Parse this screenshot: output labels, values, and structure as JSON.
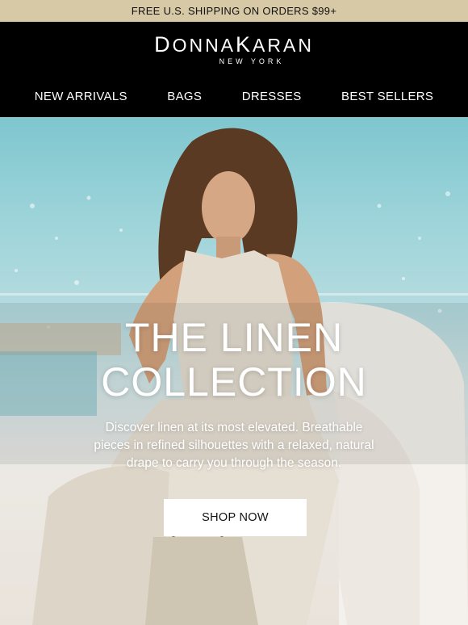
{
  "promo": {
    "text": "FREE U.S. SHIPPING ON ORDERS $99+"
  },
  "brand": {
    "name_d": "D",
    "name_onna": "ONNA",
    "name_k": "K",
    "name_aran": "ARAN",
    "subline": "NEW YORK"
  },
  "nav": {
    "items": [
      {
        "label": "NEW ARRIVALS"
      },
      {
        "label": "BAGS"
      },
      {
        "label": "DRESSES"
      },
      {
        "label": "BEST SELLERS"
      }
    ]
  },
  "hero": {
    "title_line1": "THE LINEN",
    "title_line2": "COLLECTION",
    "body_line1": "Discover linen at its most elevated. Breathable",
    "body_line2": "pieces in refined silhouettes with a relaxed, natural",
    "body_line3": "drape to carry you through the season.",
    "cta_label": "SHOP NOW"
  },
  "colors": {
    "promo_bg": "#d8c9a6",
    "header_bg": "#000000",
    "cta_bg": "#ffffff",
    "text_light": "#ffffff"
  }
}
